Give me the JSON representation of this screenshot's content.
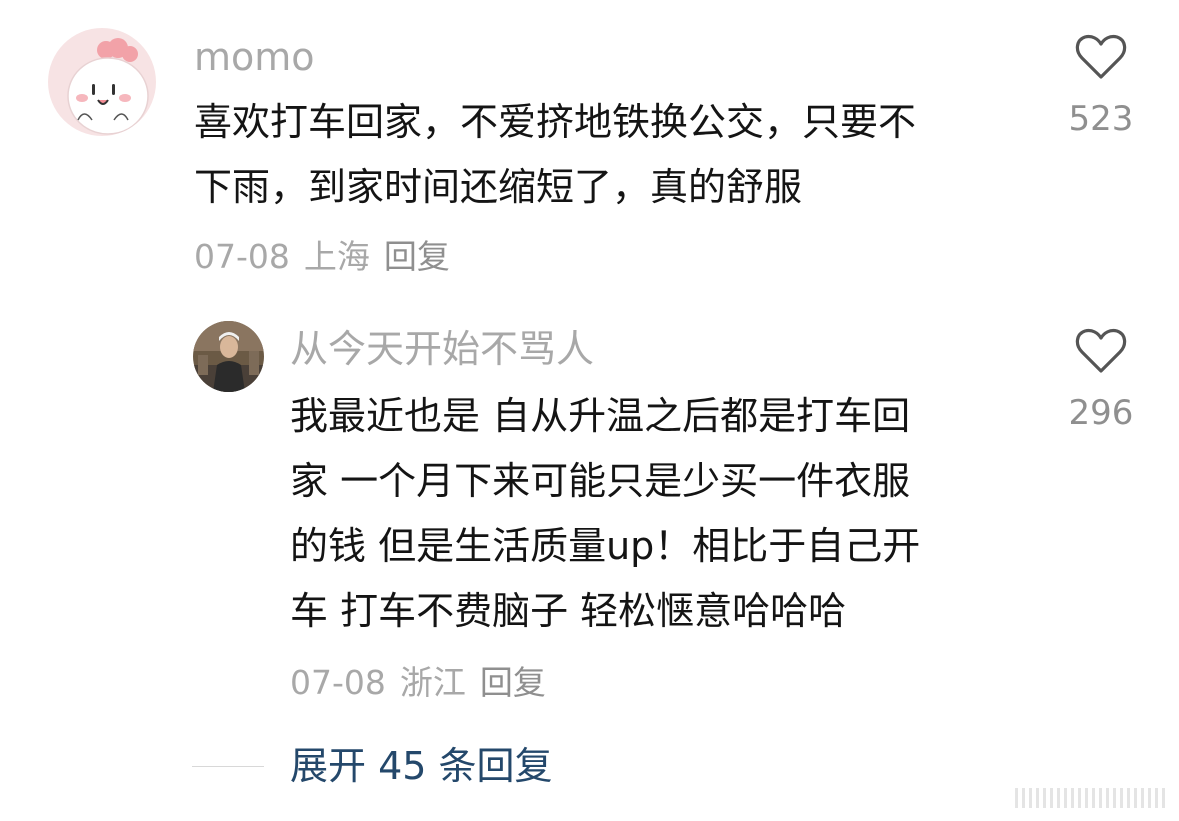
{
  "comment": {
    "username": "momo",
    "text": "喜欢打车回家，不爱挤地铁换公交，只要不\n下雨，到家时间还缩短了，真的舒服",
    "date": "07-08",
    "location": "上海",
    "reply_label": "回复",
    "like_count": "523",
    "avatar_icon": "cartoon-chick-avatar"
  },
  "reply": {
    "username": "从今天开始不骂人",
    "text": "我最近也是 自从升温之后都是打车回\n家 一个月下来可能只是少买一件衣服\n的钱 但是生活质量up！相比于自己开\n车 打车不费脑子 轻松惬意哈哈哈",
    "date": "07-08",
    "location": "浙江",
    "reply_label": "回复",
    "like_count": "296",
    "avatar_icon": "person-photo-avatar"
  },
  "expand": {
    "label": "展开 45 条回复"
  },
  "colors": {
    "meta_gray": "#a8a8a8",
    "text": "#141414",
    "link_blue": "#24486b"
  }
}
